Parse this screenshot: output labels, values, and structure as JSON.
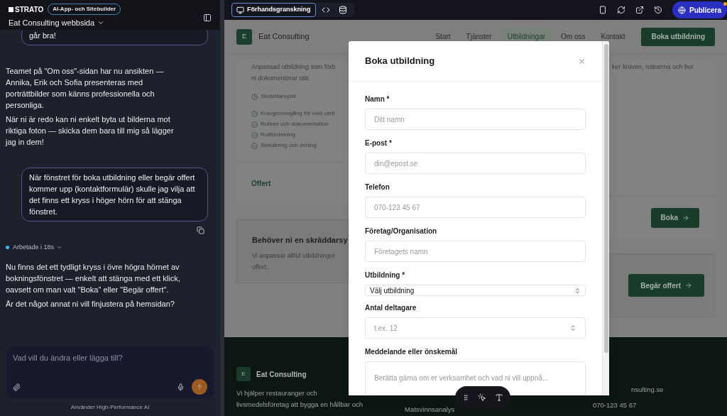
{
  "app": {
    "brand": "STRATO",
    "badge": "AI-App- och Sitebuilder",
    "project": "Eat Consulting webbsida"
  },
  "chat": {
    "messages": [
      {
        "kind": "user",
        "paragraphs": [
          "går bra!"
        ]
      },
      {
        "kind": "assistant",
        "paragraphs": [
          "Teamet på \"Om oss\"-sidan har nu ansikten — Annika, Erik och Sofia presenteras med porträttbilder som känns professionella och personliga.",
          "När ni är redo kan ni enkelt byta ut bilderna mot riktiga foton — skicka dem bara till mig så lägger jag in dem!"
        ]
      },
      {
        "kind": "user",
        "paragraphs": [
          "När fönstret för boka utbildning eller begär offert kommer upp (kontaktformulär) skulle jag vilja att det finns ett kryss i höger hörn för att stänga fönstret."
        ]
      },
      {
        "kind": "status",
        "paragraphs": [
          "Arbetade i 18s"
        ]
      },
      {
        "kind": "assistant",
        "paragraphs": [
          "Nu finns det ett tydligt kryss i övre högra hörnet av bokningsfönstret — enkelt att stänga med ett klick, oavsett om man valt \"Boka\" eller \"Begär offert\".",
          "Är det något annat ni vill finjustera på hemsidan?"
        ]
      }
    ],
    "input": {
      "placeholder": "Vad vill du ändra eller lägga till?"
    },
    "footer": "Använder High-Performance AI"
  },
  "toolbar": {
    "tabs": [
      {
        "kind": "preview",
        "label": "Förhandsgranskning",
        "selected": true
      },
      {
        "kind": "code",
        "selected": false
      },
      {
        "kind": "database",
        "selected": false
      }
    ],
    "publish": "Publicera"
  },
  "site": {
    "nav": {
      "logo": "E",
      "name": "Eat Consulting",
      "links": [
        {
          "label": "Start",
          "selected": false
        },
        {
          "label": "Tjänster",
          "selected": false
        },
        {
          "label": "Utbildningar",
          "selected": true
        },
        {
          "label": "Om oss",
          "selected": false
        },
        {
          "label": "Kontakt",
          "selected": false
        }
      ],
      "cta": "Boka utbildning"
    },
    "course": {
      "description_left": [
        "Anpassad utbildning som förb",
        "ni dokumenterar rätt."
      ],
      "description_right": "ker kraven, rutinerna och hur",
      "duration": "Skräddarsydd",
      "items": [
        "Kravgenomgång för vald certi",
        "Rutiner och dokumentation",
        "Rollfördelning",
        "Simulering och övning"
      ],
      "price": "Offert",
      "button": "Boka"
    },
    "custom": {
      "title": "Behöver ni en skräddarsy",
      "text": [
        "Vi anpassar alltid utbildninger",
        "offert."
      ],
      "button": "Begär offert"
    },
    "footer": {
      "logo": "E",
      "name": "Eat Consulting",
      "text": [
        "Vi hjälper restauranger och",
        "livsmedelsföretag att bygga en hållbar och"
      ],
      "link": "Matsvinnsanalys",
      "email": "nsulting.se",
      "phone": "070-123 45 67"
    }
  },
  "modal": {
    "title": "Boka utbildning",
    "fields": [
      {
        "kind": "text",
        "label": "Namn *",
        "placeholder": "Ditt namn"
      },
      {
        "kind": "text",
        "label": "E-post *",
        "placeholder": "din@epost.se"
      },
      {
        "kind": "text",
        "label": "Telefon",
        "placeholder": "070-123 45 67"
      },
      {
        "kind": "text",
        "label": "Företag/Organisation",
        "placeholder": "Företagets namn"
      },
      {
        "kind": "select",
        "label": "Utbildning *",
        "value": "Välj utbildning"
      },
      {
        "kind": "number",
        "label": "Antal deltagare",
        "placeholder": "t.ex. 12"
      },
      {
        "kind": "textarea",
        "label": "Meddelande eller önskemål",
        "placeholder": "Berätta gärna om er verksamhet och vad ni vill uppnå..."
      }
    ]
  }
}
